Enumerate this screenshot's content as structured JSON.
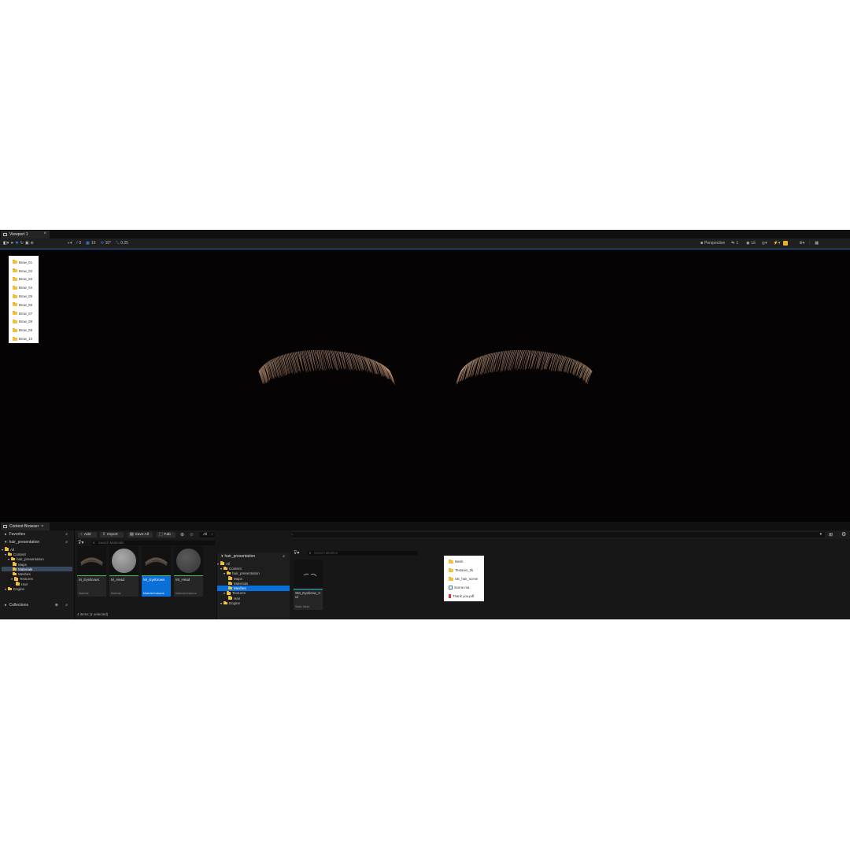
{
  "viewport": {
    "tab_label": "Viewport 1",
    "toolbar": {
      "snap_translate": "0",
      "grid_size": "10",
      "rotate_snap": "10°",
      "scale_snap": "0.25",
      "camera": "Perspective",
      "speed": "1",
      "view_mode": "Lit"
    },
    "brow_folders": [
      "Brow_01",
      "Brow_02",
      "Brow_03",
      "Brow_04",
      "Brow_05",
      "Brow_06",
      "Brow_07",
      "Brow_08",
      "Brow_09",
      "Brow_10"
    ]
  },
  "content_browser": {
    "tab_label": "Content Browser",
    "favorites_label": "Favorites",
    "project_label": "hair_presentation",
    "collections_label": "Collections",
    "tree": [
      {
        "label": "All",
        "depth": 0,
        "selected": false
      },
      {
        "label": "Content",
        "depth": 1,
        "selected": false
      },
      {
        "label": "hair_presentation",
        "depth": 2,
        "selected": false
      },
      {
        "label": "Maps",
        "depth": 3,
        "selected": false
      },
      {
        "label": "Materials",
        "depth": 3,
        "selected": true
      },
      {
        "label": "Meshes",
        "depth": 3,
        "selected": false
      },
      {
        "label": "Textures",
        "depth": 3,
        "selected": false
      },
      {
        "label": "Hair",
        "depth": 4,
        "selected": false
      },
      {
        "label": "Engine",
        "depth": 1,
        "selected": false
      }
    ],
    "buttons": {
      "add": "Add",
      "import": "Import",
      "save_all": "Save All",
      "fab": "Fab"
    },
    "breadcrumb": [
      "All",
      "Content",
      "hair_presentation",
      "Materials"
    ],
    "search_placeholder": "Search Materials",
    "assets": [
      {
        "name": "M_Eyebrows",
        "type": "Material",
        "selected": false,
        "thumb": "brow"
      },
      {
        "name": "M_Head",
        "type": "Material",
        "selected": false,
        "thumb": "sphere"
      },
      {
        "name": "MI_Eyebrows",
        "type": "Material Instance",
        "selected": true,
        "thumb": "brow"
      },
      {
        "name": "MI_Head",
        "type": "Material Instance",
        "selected": false,
        "thumb": "sphere-dark"
      }
    ],
    "status": "4 items (1 selected)"
  },
  "second_panel": {
    "header": "hair_presentation",
    "tree": [
      {
        "label": "All",
        "depth": 0,
        "selected": false
      },
      {
        "label": "Content",
        "depth": 1,
        "selected": false
      },
      {
        "label": "hair_presentation",
        "depth": 2,
        "selected": false
      },
      {
        "label": "Maps",
        "depth": 3,
        "selected": false
      },
      {
        "label": "Materials",
        "depth": 3,
        "selected": false
      },
      {
        "label": "Meshes",
        "depth": 3,
        "selected": true
      },
      {
        "label": "Textures",
        "depth": 2,
        "selected": false
      },
      {
        "label": "Hair",
        "depth": 3,
        "selected": false
      },
      {
        "label": "Engine",
        "depth": 1,
        "selected": false
      }
    ],
    "search_placeholder": "Search Meshes",
    "asset": {
      "name": "SM_Eyebrow_Cut",
      "type": "Static Mesh"
    }
  },
  "file_list": [
    {
      "label": "Mesh",
      "kind": "folder"
    },
    {
      "label": "Textures_2k",
      "kind": "folder"
    },
    {
      "label": "UE_hair_scene",
      "kind": "folder"
    },
    {
      "label": "Scene.ma",
      "kind": "maya"
    },
    {
      "label": "Thank you.pdf",
      "kind": "pdf"
    }
  ]
}
